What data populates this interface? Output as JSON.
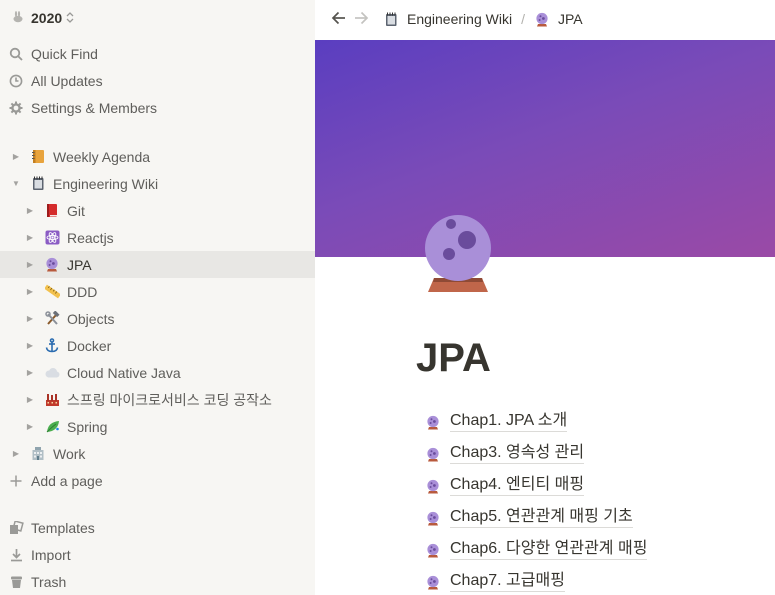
{
  "workspace": {
    "name": "2020"
  },
  "nav": [
    {
      "label": "Quick Find",
      "icon": "search-icon"
    },
    {
      "label": "All Updates",
      "icon": "clock-icon"
    },
    {
      "label": "Settings & Members",
      "icon": "gear-icon"
    }
  ],
  "tree": [
    {
      "label": "Weekly Agenda",
      "icon": "notebook-icon",
      "expanded": false
    },
    {
      "label": "Engineering Wiki",
      "icon": "spiral-notepad-icon",
      "expanded": true
    },
    {
      "label": "Git",
      "icon": "closed-book-icon"
    },
    {
      "label": "Reactjs",
      "icon": "atom-icon"
    },
    {
      "label": "JPA",
      "icon": "crystal-ball-icon",
      "active": true
    },
    {
      "label": "DDD",
      "icon": "ruler-icon"
    },
    {
      "label": "Objects",
      "icon": "hammer-wrench-icon"
    },
    {
      "label": "Docker",
      "icon": "anchor-icon"
    },
    {
      "label": "Cloud Native Java",
      "icon": "cloud-icon"
    },
    {
      "label": "스프링 마이크로서비스 코딩 공작소",
      "icon": "factory-icon"
    },
    {
      "label": "Spring",
      "icon": "leaf-icon"
    },
    {
      "label": "Work",
      "icon": "office-icon",
      "expanded": false
    }
  ],
  "add_page": {
    "label": "Add a page"
  },
  "footer": [
    {
      "label": "Templates",
      "icon": "templates-icon"
    },
    {
      "label": "Import",
      "icon": "import-icon"
    },
    {
      "label": "Trash",
      "icon": "trash-icon"
    }
  ],
  "breadcrumb": [
    {
      "label": "Engineering Wiki",
      "icon": "spiral-notepad-icon"
    },
    {
      "label": "JPA",
      "icon": "crystal-ball-icon"
    }
  ],
  "breadcrumb_separator": "/",
  "page": {
    "title": "JPA",
    "icon": "crystal-ball-icon",
    "subpages": [
      "Chap1. JPA 소개",
      "Chap3. 영속성 관리",
      "Chap4. 엔티티 매핑",
      "Chap5. 연관관계 매핑 기초",
      "Chap6. 다양한 연관관계 매핑",
      "Chap7. 고급매핑"
    ]
  },
  "colors": {
    "sidebar_bg": "#f7f6f3",
    "active_row": "#e8e7e4",
    "cover_start": "#5a3ec0",
    "cover_end": "#9a4aa6",
    "text": "#37352f"
  }
}
